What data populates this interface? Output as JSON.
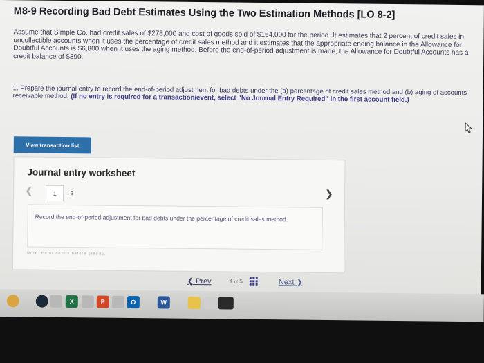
{
  "page": {
    "title": "M8-9 Recording Bad Debt Estimates Using the Two Estimation Methods [LO 8-2]",
    "paragraph": "Assume that Simple Co. had credit sales of $278,000 and cost of goods sold of $164,000 for the period. It estimates that 2 percent of credit sales in uncollectible accounts when it uses the percentage of credit sales method and it estimates that the appropriate ending balance in the Allowance for Doubtful Accounts is $6,800 when it uses the aging method. Before the end-of-period adjustment is made, the Allowance for Doubtful Accounts has a credit balance of $390.",
    "question_text": "1. Prepare the journal entry to record the end-of-period adjustment for bad debts under the (a) percentage of credit sales method and (b) aging of accounts receivable method.",
    "question_note": "(If no entry is required for a transaction/event, select \"No Journal Entry Required\" in the first account field.)"
  },
  "buttons": {
    "view_transactions": "View transaction list"
  },
  "worksheet": {
    "title": "Journal entry worksheet",
    "tabs": [
      "1",
      "2"
    ],
    "active_tab": 0,
    "instruction": "Record the end-of-period adjustment for bad debts under the percentage of credit sales method.",
    "note": "Note: Enter debits before credits."
  },
  "pagination": {
    "prev": "Prev",
    "current": "4",
    "of": "of",
    "total": "5",
    "next": "Next"
  },
  "taskbar": {
    "icons": [
      {
        "name": "chrome-icon",
        "label": "",
        "color": "#d9a441"
      },
      {
        "name": "steam-icon",
        "label": "",
        "color": "#1b2838"
      },
      {
        "name": "blank-icon",
        "label": "",
        "color": "#b8b8b8"
      },
      {
        "name": "excel-icon",
        "label": "X",
        "color": "#1f7244"
      },
      {
        "name": "blank-icon-2",
        "label": "",
        "color": "#b8b8b8"
      },
      {
        "name": "powerpoint-icon",
        "label": "P",
        "color": "#d24726"
      },
      {
        "name": "blank-icon-3",
        "label": "",
        "color": "#b8b8b8"
      },
      {
        "name": "outlook-icon",
        "label": "O",
        "color": "#0a64ad"
      },
      {
        "name": "word-icon",
        "label": "W",
        "color": "#2b5797"
      },
      {
        "name": "notes-icon",
        "label": "",
        "color": "#e8c24a"
      },
      {
        "name": "photos-icon",
        "label": "",
        "color": "#cfcfcf"
      },
      {
        "name": "terminal-icon",
        "label": "",
        "color": "#2a2a2a"
      }
    ]
  }
}
